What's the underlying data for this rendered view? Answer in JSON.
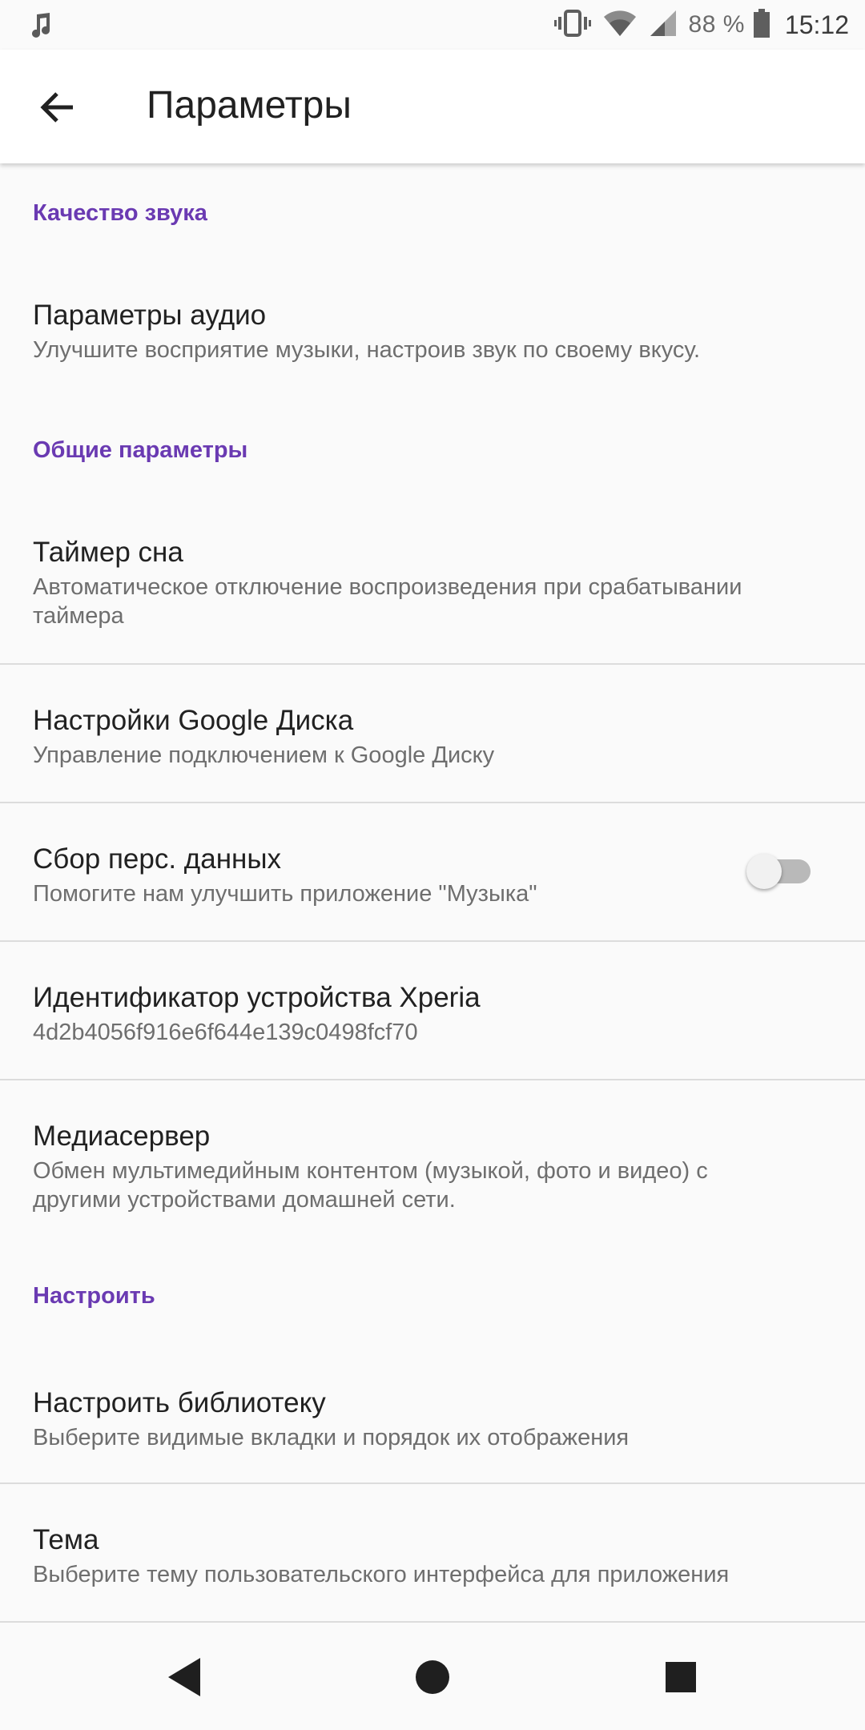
{
  "status_bar": {
    "notification_icon": "music-note-icon",
    "battery_percent": "88 %",
    "time": "15:12"
  },
  "app_bar": {
    "title": "Параметры"
  },
  "sections": {
    "sound_quality": {
      "header": "Качество звука",
      "audio": {
        "title": "Параметры аудио",
        "subtitle": "Улучшите восприятие музыки, настроив звук по своему вкусу."
      }
    },
    "general": {
      "header": "Общие параметры",
      "sleep_timer": {
        "title": "Таймер сна",
        "subtitle": "Автоматическое отключение воспроизведения при срабатывании таймера"
      },
      "google_drive": {
        "title": "Настройки Google Диска",
        "subtitle": "Управление подключением к Google Диску"
      },
      "data_collection": {
        "title": "Сбор перс. данных",
        "subtitle": "Помогите нам улучшить приложение \"Музыка\"",
        "toggle_on": false
      },
      "xperia_id": {
        "title": "Идентификатор устройства Xperia",
        "subtitle": "4d2b4056f916e6f644e139c0498fcf70"
      },
      "media_server": {
        "title": "Медиасервер",
        "subtitle": "Обмен мультимедийным контентом (музыкой, фото и видео) с другими устройствами домашней сети."
      }
    },
    "customize": {
      "header": "Настроить",
      "library": {
        "title": "Настроить библиотеку",
        "subtitle": "Выберите видимые вкладки и порядок их отображения"
      },
      "theme": {
        "title": "Тема",
        "subtitle": "Выберите тему пользовательского интерфейса для приложения"
      }
    }
  },
  "colors": {
    "accent": "#6a3ab2",
    "background": "#fafafa"
  }
}
